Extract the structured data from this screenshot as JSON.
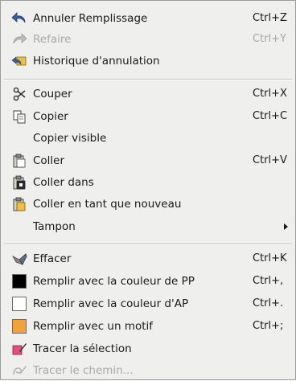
{
  "colors": {
    "fg_swatch": "#000000",
    "bg_swatch": "#ffffff",
    "pattern_swatch": "#f2a23a",
    "disabled_text": "#a8a8a8"
  },
  "menu": {
    "undo": {
      "label": "Annuler Remplissage",
      "shortcut": "Ctrl+Z",
      "icon": "undo-arrow-icon"
    },
    "redo": {
      "label": "Refaire",
      "shortcut": "Ctrl+Y",
      "icon": "redo-arrow-icon",
      "disabled": true
    },
    "history": {
      "label": "Historique d'annulation",
      "icon": "undo-history-icon"
    },
    "cut": {
      "label": "Couper",
      "shortcut": "Ctrl+X",
      "icon": "scissors-icon"
    },
    "copy": {
      "label": "Copier",
      "shortcut": "Ctrl+C",
      "icon": "copy-icon"
    },
    "copy_visible": {
      "label": "Copier visible"
    },
    "paste": {
      "label": "Coller",
      "shortcut": "Ctrl+V",
      "icon": "paste-clipboard-icon"
    },
    "paste_into": {
      "label": "Coller dans",
      "icon": "paste-into-icon"
    },
    "paste_new": {
      "label": "Coller en tant que nouveau",
      "icon": "paste-as-new-icon"
    },
    "buffer": {
      "label": "Tampon",
      "icon": "submenu-arrow-icon"
    },
    "clear": {
      "label": "Effacer",
      "shortcut": "Ctrl+K",
      "icon": "eraser-icon"
    },
    "fill_fg": {
      "label": "Remplir avec la couleur de PP",
      "shortcut": "Ctrl+,",
      "icon": "fg-color-swatch-icon"
    },
    "fill_bg": {
      "label": "Remplir avec la couleur d'AP",
      "shortcut": "Ctrl+.",
      "icon": "bg-color-swatch-icon"
    },
    "fill_pattern": {
      "label": "Remplir avec un motif",
      "shortcut": "Ctrl+;",
      "icon": "pattern-swatch-icon"
    },
    "stroke_selection": {
      "label": "Tracer la sélection",
      "icon": "stroke-selection-icon"
    },
    "stroke_path": {
      "label": "Tracer le chemin...",
      "icon": "stroke-path-icon",
      "disabled": true
    }
  }
}
